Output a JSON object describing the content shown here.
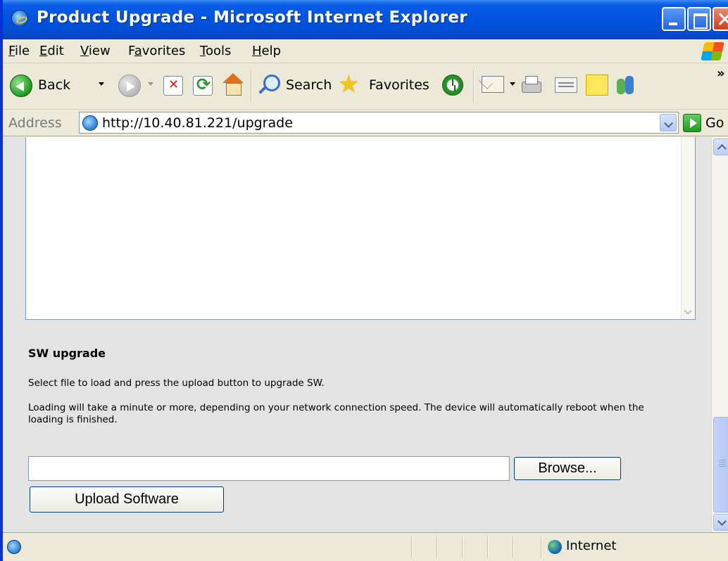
{
  "window": {
    "title": "Product Upgrade - Microsoft Internet Explorer"
  },
  "menu": {
    "items": [
      {
        "label": "File",
        "accel": "F"
      },
      {
        "label": "Edit",
        "accel": "E"
      },
      {
        "label": "View",
        "accel": "V"
      },
      {
        "label": "Favorites",
        "accel": "a"
      },
      {
        "label": "Tools",
        "accel": "T"
      },
      {
        "label": "Help",
        "accel": "H"
      }
    ]
  },
  "toolbar": {
    "back_label": "Back",
    "search_label": "Search",
    "favorites_label": "Favorites",
    "overflow": "»"
  },
  "address": {
    "label": "Address",
    "url": "http://10.40.81.221/upgrade",
    "go_label": "Go"
  },
  "page": {
    "section_title": "SW upgrade",
    "instruction": "Select file to load and press the upload button to upgrade SW.",
    "notice": "Loading will take a minute or more, depending on your network connection speed. The device will automatically reboot when the loading is finished.",
    "file_value": "",
    "browse_label": "Browse...",
    "upload_label": "Upload Software"
  },
  "status": {
    "zone": "Internet"
  },
  "icons": {
    "title": "ie-logo-icon",
    "back": "back-arrow-icon",
    "forward": "forward-arrow-icon",
    "stop": "stop-icon",
    "refresh": "refresh-icon",
    "home": "home-icon",
    "search": "magnifier-icon",
    "favorites": "star-icon",
    "history": "history-icon",
    "mail": "mail-icon",
    "print": "printer-icon",
    "edit": "edit-icon",
    "discuss": "note-icon",
    "messenger": "messenger-icon",
    "zone": "globe-icon"
  }
}
